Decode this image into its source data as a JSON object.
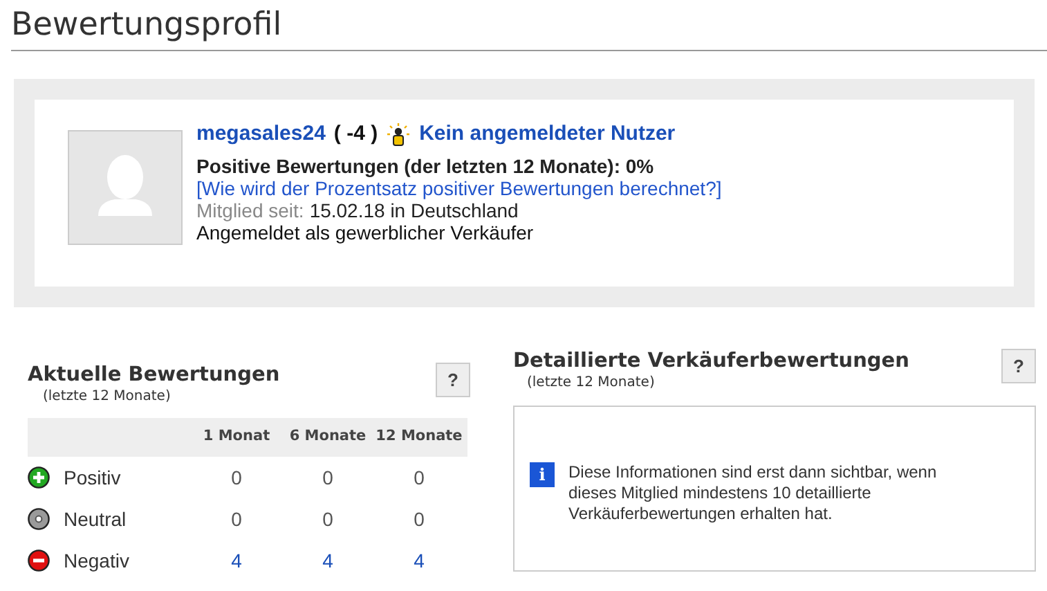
{
  "page_title": "Bewertungsprofil",
  "profile": {
    "username": "megasales24",
    "score": "( -4 )",
    "status_link": "Kein angemeldeter Nutzer",
    "positive_rate": "Positive Bewertungen (der letzten 12 Monate): 0%",
    "help_link": "[Wie wird der Prozentsatz positiver Bewertungen berechnet?]",
    "member_since_label": "Mitglied seit:",
    "member_since_value": "15.02.18 in Deutschland",
    "seller_type": "Angemeldet als gewerblicher Verkäufer"
  },
  "current_ratings": {
    "title": "Aktuelle Bewertungen",
    "subtitle": "(letzte 12 Monate)",
    "help_button": "?",
    "columns": [
      "1 Monat",
      "6 Monate",
      "12 Monate"
    ],
    "rows": [
      {
        "kind": "positive",
        "label": "Positiv",
        "linked": false,
        "values": [
          "0",
          "0",
          "0"
        ]
      },
      {
        "kind": "neutral",
        "label": "Neutral",
        "linked": false,
        "values": [
          "0",
          "0",
          "0"
        ]
      },
      {
        "kind": "negative",
        "label": "Negativ",
        "linked": true,
        "values": [
          "4",
          "4",
          "4"
        ]
      }
    ]
  },
  "detailed_ratings": {
    "title": "Detaillierte Verkäuferbewertungen",
    "subtitle": "(letzte 12 Monate)",
    "help_button": "?",
    "info_icon": "i",
    "message": "Diese Informationen sind erst dann sichtbar, wenn dieses Mitglied mindestens 10 detaillierte Verkäuferbewertungen erhalten hat."
  }
}
